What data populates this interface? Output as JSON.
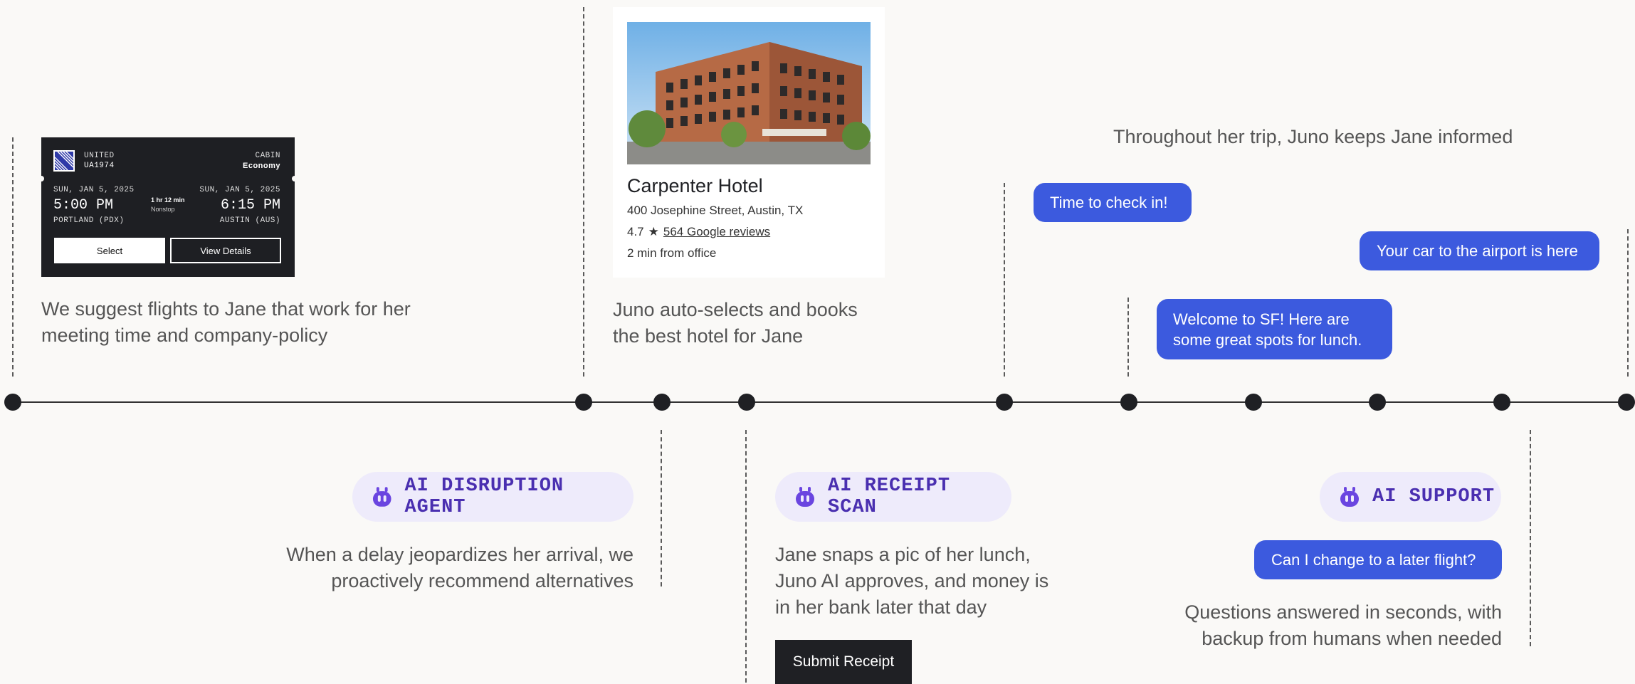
{
  "flight": {
    "airline": "UNITED",
    "flight_number": "UA1974",
    "cabin_label": "CABIN",
    "cabin_value": "Economy",
    "depart_date": "SUN, JAN 5, 2025",
    "depart_time": "5:00 PM",
    "depart_city": "PORTLAND (PDX)",
    "duration": "1 hr 12 min",
    "stops": "Nonstop",
    "arrive_date": "SUN, JAN 5, 2025",
    "arrive_time": "6:15 PM",
    "arrive_city": "AUSTIN (AUS)",
    "select_label": "Select",
    "details_label": "View Details",
    "caption_line1": "We suggest flights to Jane that work for her",
    "caption_line2": "meeting time and company-policy"
  },
  "hotel": {
    "name": "Carpenter Hotel",
    "address": "400 Josephine Street, Austin, TX",
    "rating": "4.7",
    "star": "★",
    "reviews": "564 Google reviews",
    "distance": "2 min from office",
    "caption_line1": "Juno auto-selects and books",
    "caption_line2": "the best hotel for Jane"
  },
  "notifications": {
    "heading": "Throughout her trip, Juno keeps Jane informed",
    "bubble_checkin": "Time to check in!",
    "bubble_car": "Your car to the airport is here",
    "bubble_sf_line1": "Welcome to SF! Here are",
    "bubble_sf_line2": "some great spots for lunch."
  },
  "disruption": {
    "label": "AI DISRUPTION AGENT",
    "caption_line1": "When a delay jeopardizes her arrival, we",
    "caption_line2": "proactively recommend alternatives"
  },
  "receipt": {
    "label": "AI RECEIPT SCAN",
    "caption_line1": "Jane snaps a pic of her lunch,",
    "caption_line2": "Juno AI approves, and money is",
    "caption_line3": "in her bank later that day",
    "button_label": "Submit Receipt"
  },
  "support": {
    "label": "AI SUPPORT",
    "bubble": "Can I change to a later flight?",
    "caption_line1": "Questions answered in seconds, with",
    "caption_line2": "backup from humans when needed"
  },
  "colors": {
    "accent_blue": "#3c5ade",
    "ai_purple": "#6a45e0",
    "pill_bg": "#eeebfb",
    "dark": "#1f2024",
    "background": "#faf9f7"
  },
  "icons": {
    "airline_logo": "united-globe-icon",
    "ai_badge": "robot-icon",
    "rating": "star-icon"
  }
}
